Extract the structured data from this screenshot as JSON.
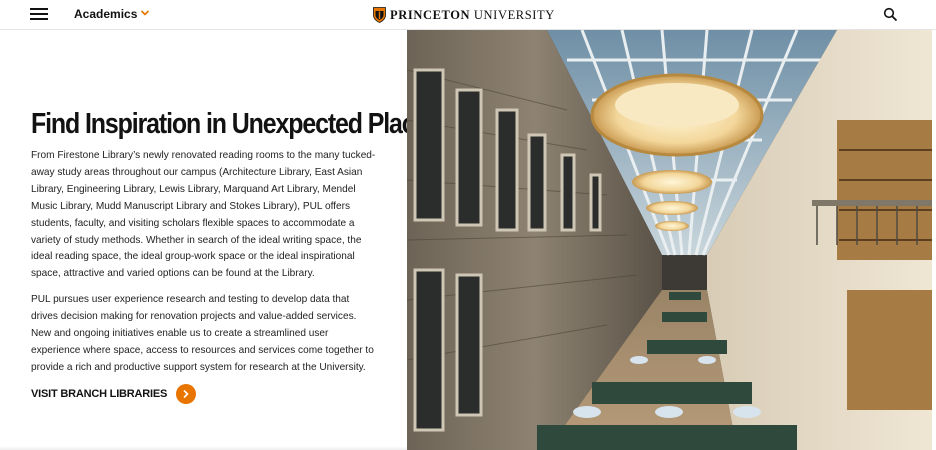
{
  "header": {
    "menu_icon": "hamburger-menu-icon",
    "nav_label": "Academics",
    "chevron_icon": "chevron-down-icon",
    "brand_bold": "PRINCETON",
    "brand_regular": "UNIVERSITY",
    "logo_icon": "princeton-shield-icon",
    "search_icon": "search-icon"
  },
  "main": {
    "heading": "Find Inspiration in Unexpected Places",
    "paragraph1": "From Firestone Library’s newly renovated reading rooms to the many tucked-away study areas throughout our campus (Architecture Library, East Asian Library, Engineering Library, Lewis Library, Marquand Art Library, Mendel Music Library, Mudd Manuscript Library and Stokes Library), PUL offers students, faculty, and visiting scholars flexible spaces to accommodate a variety of study methods. Whether in search of the ideal writing space, the ideal reading space, the ideal group-work space or the ideal inspirational space, attractive and varied options can be found at the Library.",
    "paragraph2": "PUL pursues user experience research and testing to develop data that drives decision making for renovation projects and value-added services. New and ongoing initiatives enable us to create a streamlined user experience where space, access to resources and services come together to provide a rich and productive support system for research at the University.",
    "cta_label": "VISIT BRANCH LIBRARIES",
    "cta_icon": "arrow-right-icon"
  },
  "photo": {
    "subject": "library-reading-room-photo"
  },
  "colors": {
    "accent": "#e77500",
    "text": "#121212"
  }
}
